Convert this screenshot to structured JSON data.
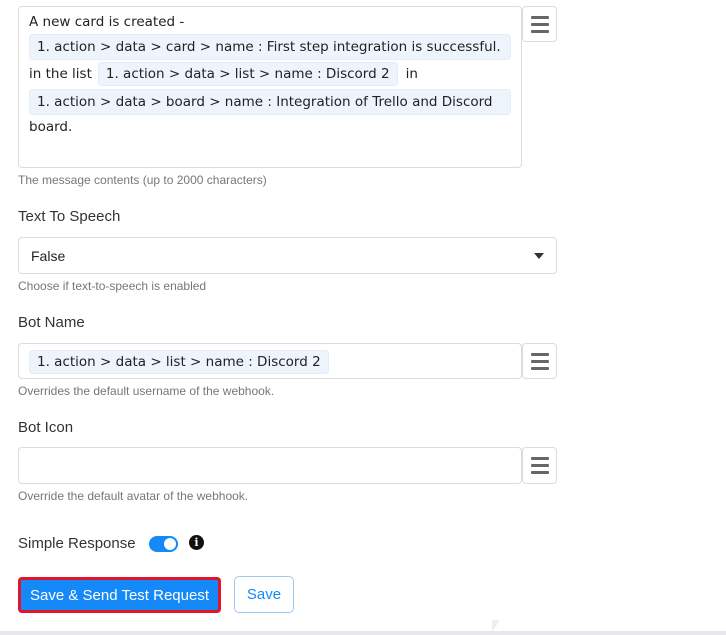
{
  "message": {
    "intro": "A new card is created -",
    "pill1": "1. action > data > card > name : First step integration is successful.",
    "mid": "in the list",
    "pill2": "1. action > data > list > name : Discord 2",
    "in": "in",
    "pill3": "1. action > data > board > name : Integration of Trello and Discord",
    "end": "board.",
    "help": "The message contents (up to 2000 characters)"
  },
  "tts": {
    "label": "Text To Speech",
    "value": "False",
    "help": "Choose if text-to-speech is enabled"
  },
  "bot_name": {
    "label": "Bot Name",
    "pill": "1. action > data > list > name : Discord 2",
    "help": "Overrides the default username of the webhook."
  },
  "bot_icon": {
    "label": "Bot Icon",
    "value": "",
    "help": "Override the default avatar of the webhook."
  },
  "simple_response": {
    "label": "Simple Response",
    "enabled": true
  },
  "buttons": {
    "save_send": "Save & Send Test Request",
    "save": "Save"
  },
  "colors": {
    "primary": "#1589f7",
    "highlight_border": "#e0142a"
  }
}
